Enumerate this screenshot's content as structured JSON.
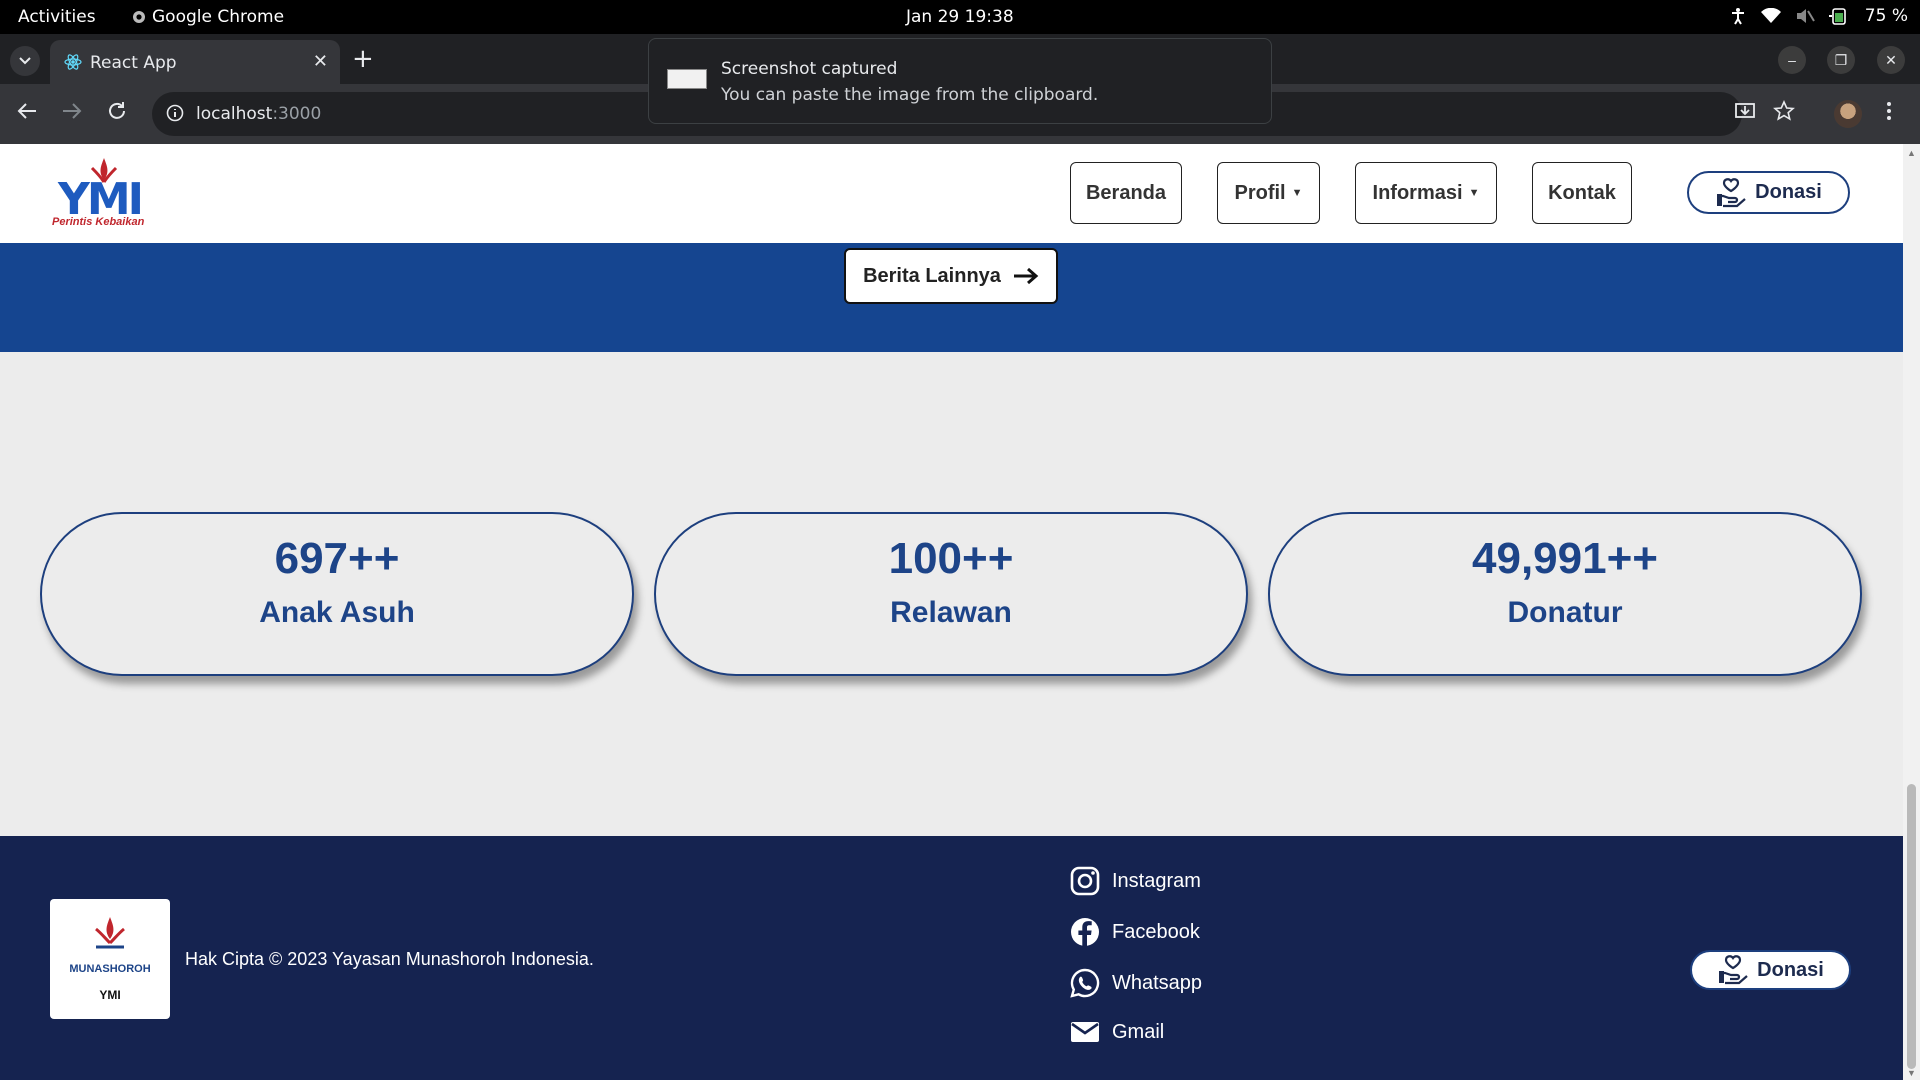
{
  "system": {
    "activities": "Activities",
    "app_name": "Google Chrome",
    "clock": "Jan 29  19:38",
    "battery": "75 %"
  },
  "browser": {
    "tab_title": "React App",
    "url_host": "localhost",
    "url_port": ":3000"
  },
  "toast": {
    "title": "Screenshot captured",
    "message": "You can paste the image from the clipboard."
  },
  "nav": {
    "logo_text": "YMI",
    "logo_tagline": "Perintis Kebaikan",
    "items": [
      {
        "label": "Beranda"
      },
      {
        "label": "Profil"
      },
      {
        "label": "Informasi"
      },
      {
        "label": "Kontak"
      }
    ],
    "donate_label": "Donasi"
  },
  "news": {
    "more_label": "Berita Lainnya"
  },
  "stats": [
    {
      "value": "697++",
      "label": "Anak Asuh"
    },
    {
      "value": "100++",
      "label": "Relawan"
    },
    {
      "value": "49,991++",
      "label": "Donatur"
    }
  ],
  "footer": {
    "logo_ring_text": "MUNASHOROH",
    "logo_caption": "YMI",
    "copyright": "Hak Cipta © 2023 Yayasan Munashoroh Indonesia.",
    "social": [
      {
        "label": "Instagram",
        "icon": "instagram-icon"
      },
      {
        "label": "Facebook",
        "icon": "facebook-icon"
      },
      {
        "label": "Whatsapp",
        "icon": "whatsapp-icon"
      },
      {
        "label": "Gmail",
        "icon": "mail-icon"
      }
    ],
    "donate_label": "Donasi"
  },
  "colors": {
    "brand_blue": "#154590",
    "footer_navy": "#152350",
    "stat_text": "#1d4488",
    "logo_red": "#c0262d"
  }
}
